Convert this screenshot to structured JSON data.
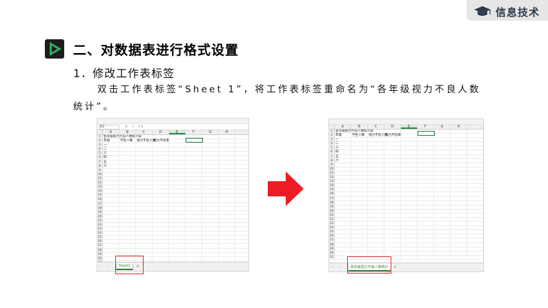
{
  "brand": {
    "title": "信息技术"
  },
  "section": {
    "title": "二、对数据表进行格式设置"
  },
  "subheading": "1．修改工作表标签",
  "paragraph": "双击工作表标签“Sheet 1”，将工作表标签重命名为“各年级视力不良人数统计”。",
  "sheet_before": {
    "namebox": "E2",
    "fx": "× ✓ fx",
    "columns": [
      "A",
      "B",
      "C",
      "D",
      "E",
      "F",
      "G",
      "H"
    ],
    "rows": [
      [
        "各年级视力不良人数统计表",
        "",
        "",
        "",
        "",
        "",
        "",
        ""
      ],
      [
        "年级",
        "学生人数",
        "视力不良人数",
        "视力不良率",
        "",
        "",
        "",
        ""
      ],
      [
        "一",
        "",
        "",
        "",
        "",
        "",
        "",
        ""
      ],
      [
        "二",
        "",
        "",
        "",
        "",
        "",
        "",
        ""
      ],
      [
        "三",
        "",
        "",
        "",
        "",
        "",
        "",
        ""
      ],
      [
        "四",
        "",
        "",
        "",
        "",
        "",
        "",
        ""
      ],
      [
        "五",
        "",
        "",
        "",
        "",
        "",
        "",
        ""
      ],
      [
        "六",
        "",
        "",
        "",
        "",
        "",
        "",
        ""
      ]
    ],
    "row_count": 31,
    "tab_label": "Sheet1"
  },
  "sheet_after": {
    "namebox": "",
    "fx": "",
    "columns": [
      "A",
      "B",
      "C",
      "D",
      "E",
      "F",
      "G",
      "H"
    ],
    "rows": [
      [
        "各年级视力不良人数统计表",
        "",
        "",
        "",
        "",
        "",
        "",
        ""
      ],
      [
        "年级",
        "学生人数",
        "视力不良人数",
        "视力不良率",
        "",
        "",
        "",
        ""
      ],
      [
        "一",
        "",
        "",
        "",
        "",
        "",
        "",
        ""
      ],
      [
        "二",
        "",
        "",
        "",
        "",
        "",
        "",
        ""
      ],
      [
        "三",
        "",
        "",
        "",
        "",
        "",
        "",
        ""
      ],
      [
        "四",
        "",
        "",
        "",
        "",
        "",
        "",
        ""
      ],
      [
        "五",
        "",
        "",
        "",
        "",
        "",
        "",
        ""
      ],
      [
        "六",
        "",
        "",
        "",
        "",
        "",
        "",
        ""
      ]
    ],
    "row_count": 31,
    "tab_label": "各年级视力不良人数统计"
  },
  "colors": {
    "highlight": "#e02a2a",
    "arrow": "#ee1c24",
    "accent": "#2f7d32",
    "play_icon": "#2fae5e"
  },
  "icons": {
    "brand": "graduation-cap-icon",
    "section": "play-icon",
    "transition": "right-arrow-icon"
  }
}
